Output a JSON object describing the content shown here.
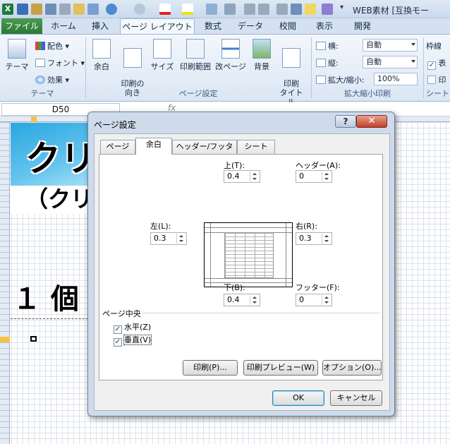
{
  "titlebar": {
    "title": "WEB素材 [互換モー"
  },
  "ribbon_tabs": [
    "ファイル",
    "ホーム",
    "挿入",
    "ページ レイアウト",
    "数式",
    "データ",
    "校閲",
    "表示",
    "開発"
  ],
  "ribbon": {
    "theme_group": {
      "theme_label": "テーマ",
      "colors": "配色",
      "fonts": "フォント",
      "effects": "効果",
      "group_label": "テーマ"
    },
    "page_setup_group": {
      "margins": "余白",
      "orientation": "印刷の\n向き",
      "size": "サイズ",
      "print_area": "印刷範囲",
      "breaks": "改ページ",
      "background": "背景",
      "print_titles": "印刷\nタイトル",
      "group_label": "ページ設定"
    },
    "scale_group": {
      "width_label": "横:",
      "width_value": "自動",
      "height_label": "縦:",
      "height_value": "自動",
      "scale_label": "拡大/縮小:",
      "scale_value": "100%",
      "group_label": "拡大縮小印刷"
    },
    "sheet_options_group": {
      "gridlines_label": "枠線",
      "view_short": "表",
      "print_short": "印",
      "group_label": "シート"
    }
  },
  "formula_bar": {
    "name_box": "D50",
    "fx": "fx"
  },
  "sheet": {
    "banner_text_1": "クリ",
    "banner_text_2": "（クリ",
    "banner_text_3": "１ 個"
  },
  "dialog": {
    "title": "ページ設定",
    "help_label": "?",
    "close_label": "✕",
    "tabs": [
      "ページ",
      "余白",
      "ヘッダー/フッター",
      "シート"
    ],
    "active_tab": "余白",
    "fields": {
      "top": {
        "label": "上(T):",
        "value": "0.4"
      },
      "header": {
        "label": "ヘッダー(A):",
        "value": "0"
      },
      "left": {
        "label": "左(L):",
        "value": "0.3"
      },
      "right": {
        "label": "右(R):",
        "value": "0.3"
      },
      "bottom": {
        "label": "下(B):",
        "value": "0.4"
      },
      "footer": {
        "label": "フッター(F):",
        "value": "0"
      }
    },
    "center_section": {
      "label": "ページ中央",
      "horizontal": {
        "label": "水平(Z)",
        "checked": true
      },
      "vertical": {
        "label": "垂直(V)",
        "checked": true
      }
    },
    "buttons": {
      "print": "印刷(P)...",
      "preview": "印刷プレビュー(W)",
      "options": "オプション(O)...",
      "ok": "OK",
      "cancel": "キャンセル"
    }
  },
  "colors": {
    "file_tab": "#2b7a34",
    "ribbon_bg": "#dbe6f4",
    "banner_blue": "#2aa7e0"
  }
}
